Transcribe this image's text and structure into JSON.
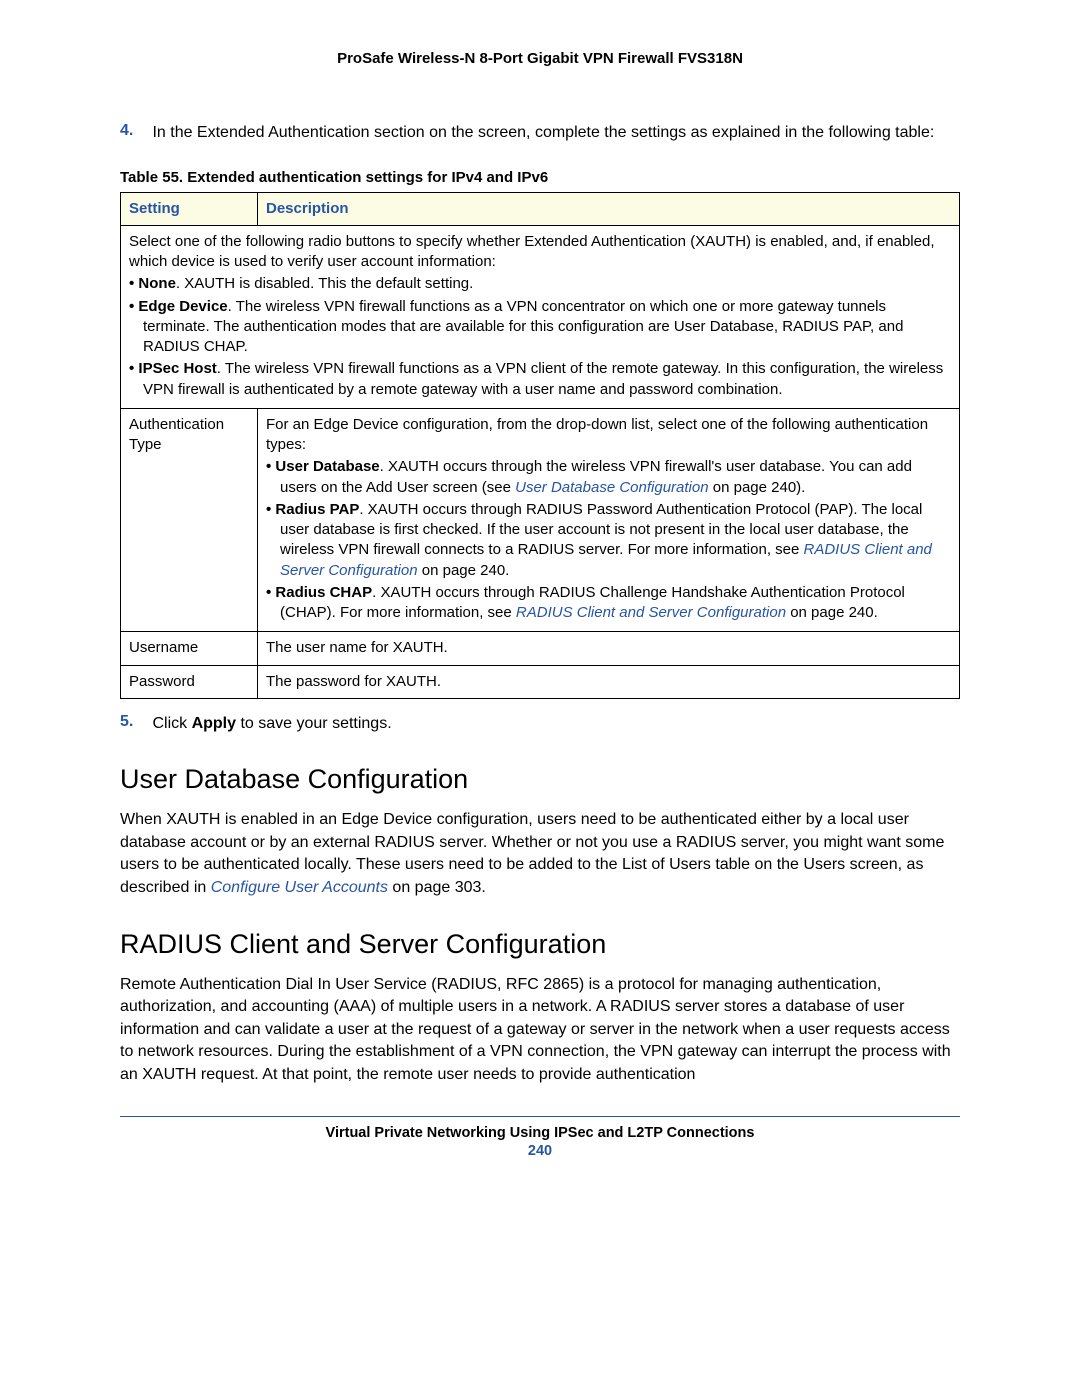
{
  "header": {
    "title": "ProSafe Wireless-N 8-Port Gigabit VPN Firewall FVS318N"
  },
  "step4": {
    "marker": "4.",
    "text": "In the Extended Authentication section on the screen, complete the settings as explained in the following table:"
  },
  "table": {
    "caption": "Table 55.  Extended authentication settings for IPv4 and IPv6",
    "col_setting": "Setting",
    "col_desc": "Description",
    "intro_row": {
      "lead": "Select one of the following radio buttons to specify whether Extended Authentication (XAUTH) is enabled, and, if enabled, which device is used to verify user account information:",
      "none_b": "None",
      "none_t": ". XAUTH is disabled. This the default setting.",
      "edge_b": "Edge Device",
      "edge_t": ". The wireless VPN firewall functions as a VPN concentrator on which one or more gateway tunnels terminate. The authentication modes that are available for this configuration are User Database, RADIUS PAP, and RADIUS CHAP.",
      "ipsec_b": "IPSec Host",
      "ipsec_t": ". The wireless VPN firewall functions as a VPN client of the remote gateway. In this configuration, the wireless VPN firewall is authenticated by a remote gateway with a user name and password combination."
    },
    "auth_row": {
      "label": "Authentication Type",
      "lead": "For an Edge Device configuration, from the drop-down list, select one of the following authentication types:",
      "udb_b": "User Database",
      "udb_t1": ". XAUTH occurs through the wireless VPN firewall's user database. You can add users on the Add User screen (see ",
      "udb_link": "User Database Configuration",
      "udb_t2": " on page 240).",
      "pap_b": "Radius PAP",
      "pap_t1": ". XAUTH occurs through RADIUS Password Authentication Protocol (PAP). The local user database is first checked. If the user account is not present in the local user database, the wireless VPN firewall connects to a RADIUS server. For more information, see ",
      "pap_link": "RADIUS Client and Server Configuration",
      "pap_t2": " on page 240.",
      "chap_b": "Radius CHAP",
      "chap_t1": ". XAUTH occurs through RADIUS Challenge Handshake Authentication Protocol (CHAP). For more information, see ",
      "chap_link": "RADIUS Client and Server Configuration",
      "chap_t2": " on page 240."
    },
    "user_row": {
      "label": "Username",
      "desc": "The user name for XAUTH."
    },
    "pass_row": {
      "label": "Password",
      "desc": "The password for XAUTH."
    }
  },
  "step5": {
    "marker": "5.",
    "pre": "Click ",
    "bold": "Apply",
    "post": " to save your settings."
  },
  "section1": {
    "heading": "User Database Configuration",
    "p_pre": "When XAUTH is enabled in an Edge Device configuration, users need to be authenticated either by a local user database account or by an external RADIUS server. Whether or not you use a RADIUS server, you might want some users to be authenticated locally. These users need to be added to the List of Users table on the Users screen, as described in ",
    "p_link": "Configure User Accounts",
    "p_post": " on page 303."
  },
  "section2": {
    "heading": "RADIUS Client and Server Configuration",
    "p": "Remote Authentication Dial In User Service (RADIUS, RFC 2865) is a protocol for managing authentication, authorization, and accounting (AAA) of multiple users in a network. A RADIUS server stores a database of user information and can validate a user at the request of a gateway or server in the network when a user requests access to network resources. During the establishment of a VPN connection, the VPN gateway can interrupt the process with an XAUTH request. At that point, the remote user needs to provide authentication"
  },
  "footer": {
    "title": "Virtual Private Networking Using IPSec and L2TP Connections",
    "page": "240"
  }
}
